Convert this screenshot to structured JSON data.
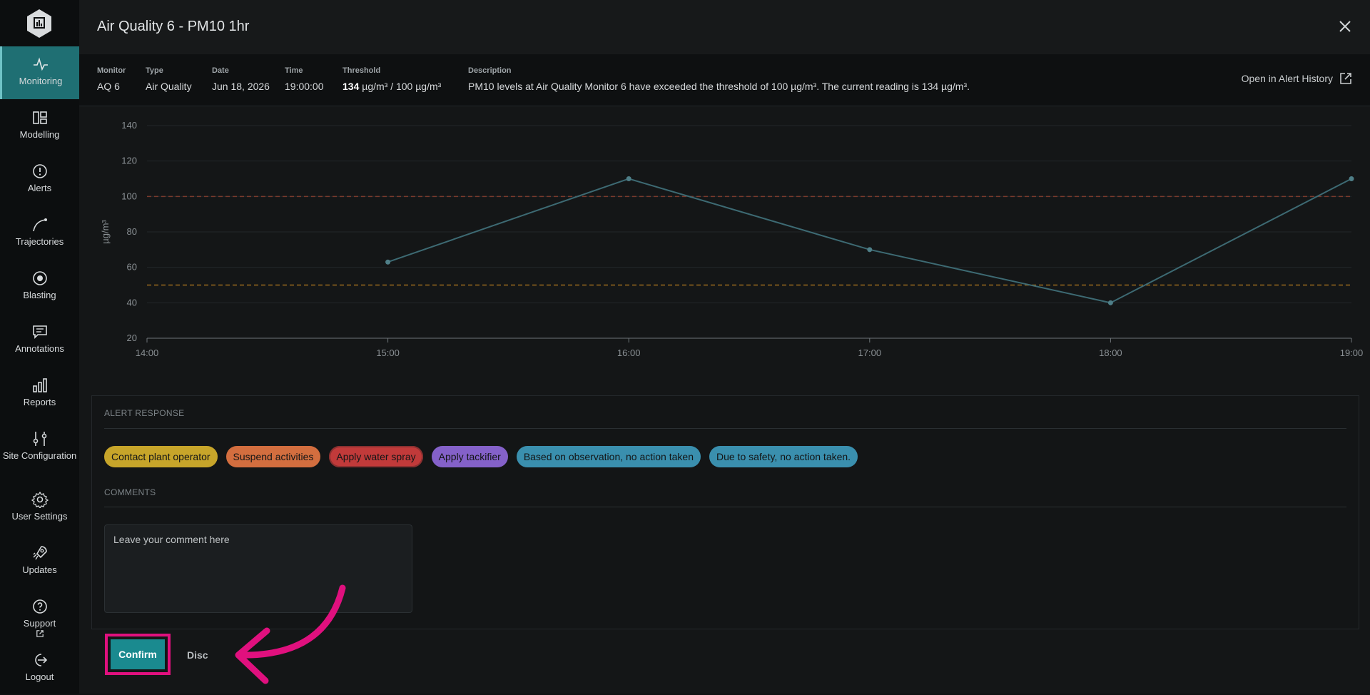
{
  "sidebar": {
    "items": [
      {
        "label": "Monitoring",
        "icon": "pulse-icon",
        "active": true
      },
      {
        "label": "Modelling",
        "icon": "modelling-icon"
      },
      {
        "label": "Alerts",
        "icon": "alert-circle-icon"
      },
      {
        "label": "Trajectories",
        "icon": "trajectory-icon"
      },
      {
        "label": "Blasting",
        "icon": "target-icon"
      },
      {
        "label": "Annotations",
        "icon": "comment-icon"
      },
      {
        "label": "Reports",
        "icon": "bar-chart-icon"
      },
      {
        "label": "Site Configuration",
        "icon": "sliders-icon"
      },
      {
        "label": "User Settings",
        "icon": "gear-icon"
      },
      {
        "label": "Updates",
        "icon": "rocket-icon"
      },
      {
        "label": "Support",
        "icon": "help-icon"
      },
      {
        "label": "Logout",
        "icon": "logout-icon"
      }
    ]
  },
  "modal": {
    "title": "Air Quality 6 - PM10 1hr",
    "meta": {
      "monitor_label": "Monitor",
      "monitor": "AQ 6",
      "type_label": "Type",
      "type": "Air Quality",
      "date_label": "Date",
      "date": "Jun 18, 2026",
      "time_label": "Time",
      "time": "19:00:00",
      "threshold_label": "Threshold",
      "threshold_value": "134",
      "threshold_rest": " µg/m³ / 100 µg/m³",
      "description_label": "Description",
      "description": "PM10 levels at Air Quality Monitor 6 have exceeded the threshold of 100 µg/m³. The current reading is 134 µg/m³."
    },
    "alert_history_link": "Open in Alert History"
  },
  "chart_data": {
    "type": "line",
    "ylabel": "µg/m³",
    "ylim": [
      20,
      140
    ],
    "yticks": [
      "20",
      "40",
      "60",
      "80",
      "100",
      "120",
      "140"
    ],
    "xticks": [
      "14:00",
      "15:00",
      "16:00",
      "17:00",
      "18:00",
      "19:00"
    ],
    "xlim": [
      14,
      19
    ],
    "series": [
      {
        "x": [
          15,
          16,
          17,
          18,
          19
        ],
        "values": [
          63,
          110,
          70,
          40,
          110
        ],
        "color": "#3d6a73"
      }
    ],
    "thresholds": [
      {
        "value": 100,
        "color": "#7a3a2c"
      },
      {
        "value": 50,
        "color": "#9a6a1e"
      }
    ],
    "grid": true
  },
  "response": {
    "section_label": "ALERT RESPONSE",
    "chips": [
      {
        "label": "Contact plant operator",
        "color": "#c7a52a"
      },
      {
        "label": "Suspend activities",
        "color": "#d36e3f"
      },
      {
        "label": "Apply water spray",
        "color": "#c13a3a"
      },
      {
        "label": "Apply tackifier",
        "color": "#8461c9"
      },
      {
        "label": "Based on observation, no action taken",
        "color": "#3a8fae"
      },
      {
        "label": "Due to safety, no action taken.",
        "color": "#3a8fae"
      }
    ],
    "comments_label": "COMMENTS",
    "comment_placeholder": "Leave your comment here"
  },
  "actions": {
    "confirm": "Confirm",
    "discard": "Disc"
  }
}
